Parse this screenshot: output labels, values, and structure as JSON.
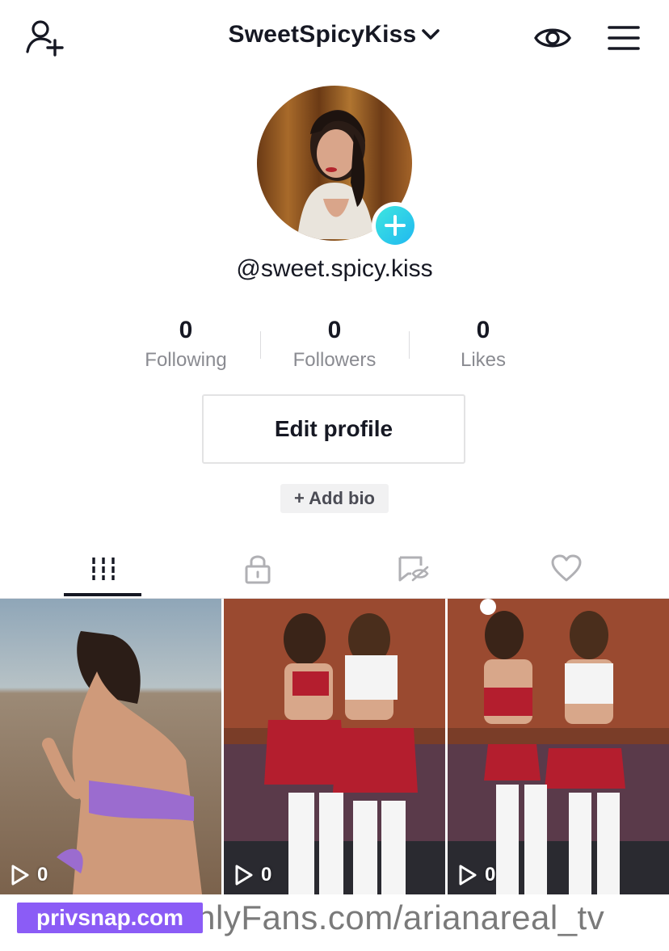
{
  "header": {
    "username": "SweetSpicyKiss",
    "icons": [
      "add-user-icon",
      "chevron-down-icon",
      "eye-icon",
      "menu-icon"
    ]
  },
  "profile": {
    "handle": "@sweet.spicy.kiss",
    "stats": [
      {
        "value": "0",
        "label": "Following"
      },
      {
        "value": "0",
        "label": "Followers"
      },
      {
        "value": "0",
        "label": "Likes"
      }
    ],
    "edit_label": "Edit profile",
    "add_bio_label": "+ Add bio"
  },
  "tabs": [
    {
      "icon": "grid-icon",
      "active": true
    },
    {
      "icon": "lock-icon",
      "active": false
    },
    {
      "icon": "hidden-bookmark-icon",
      "active": false
    },
    {
      "icon": "heart-icon",
      "active": false
    }
  ],
  "videos": [
    {
      "views": "0"
    },
    {
      "views": "0"
    },
    {
      "views": "0"
    }
  ],
  "watermark": {
    "brand": "privsnap.com",
    "url": "OnlyFans.com/arianareal_tv"
  },
  "colors": {
    "accent": "#20b8f0",
    "text": "#161823",
    "muted": "#8a8b91",
    "watermark": "#8b5cf6"
  }
}
